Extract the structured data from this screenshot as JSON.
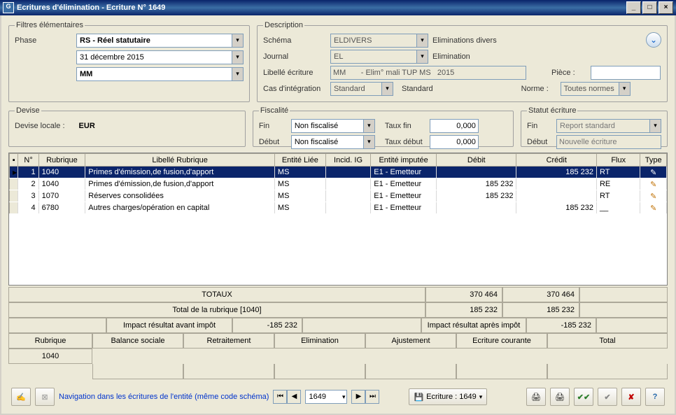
{
  "window": {
    "title": "Ecritures d'élimination - Ecriture N° 1649"
  },
  "filters": {
    "legend": "Filtres élémentaires",
    "phase_label": "Phase",
    "phase_value": "RS - Réel statutaire",
    "date_value": "31 décembre 2015",
    "code_value": "MM"
  },
  "description": {
    "legend": "Description",
    "schema_label": "Schéma",
    "schema_value": "ELDIVERS",
    "schema_desc": "Eliminations divers",
    "journal_label": "Journal",
    "journal_value": "EL",
    "journal_desc": "Elimination",
    "libelle_label": "Libellé écriture",
    "libelle_value": "MM       - Elim° mali TUP MS   2015",
    "cas_label": "Cas d'intégration",
    "cas_value": "Standard",
    "cas_desc": "Standard",
    "piece_label": "Pièce :",
    "piece_value": "",
    "norme_label": "Norme :",
    "norme_value": "Toutes normes"
  },
  "devise": {
    "legend": "Devise",
    "local_label": "Devise locale :",
    "local_value": "EUR"
  },
  "fiscalite": {
    "legend": "Fiscalité",
    "fin_label": "Fin",
    "fin_value": "Non fiscalisé",
    "debut_label": "Début",
    "debut_value": "Non fiscalisé",
    "tauxfin_label": "Taux fin",
    "tauxfin_value": "0,000",
    "tauxdebut_label": "Taux début",
    "tauxdebut_value": "0,000"
  },
  "statut": {
    "legend": "Statut écriture",
    "fin_label": "Fin",
    "fin_value": "Report standard",
    "debut_label": "Début",
    "debut_value": "Nouvelle écriture"
  },
  "grid": {
    "cols": [
      "N°",
      "Rubrique",
      "Libellé Rubrique",
      "Entité Liée",
      "Incid. IG",
      "Entité imputée",
      "Débit",
      "Crédit",
      "Flux",
      "Type"
    ],
    "rows": [
      {
        "n": "1",
        "rub": "1040",
        "lib": "Primes d'émission,de fusion,d'apport",
        "ent": "MS",
        "ig": "",
        "imp": "E1 - Emetteur",
        "debit": "",
        "credit": "185 232",
        "flux": "RT",
        "selected": true
      },
      {
        "n": "2",
        "rub": "1040",
        "lib": "Primes d'émission,de fusion,d'apport",
        "ent": "MS",
        "ig": "",
        "imp": "E1 - Emetteur",
        "debit": "185 232",
        "credit": "",
        "flux": "RE"
      },
      {
        "n": "3",
        "rub": "1070",
        "lib": "Réserves consolidées",
        "ent": "MS",
        "ig": "",
        "imp": "E1 - Emetteur",
        "debit": "185 232",
        "credit": "",
        "flux": "RT"
      },
      {
        "n": "4",
        "rub": "6780",
        "lib": "Autres charges/opération en capital",
        "ent": "MS",
        "ig": "",
        "imp": "E1 - Emetteur",
        "debit": "",
        "credit": "185 232",
        "flux": "__"
      }
    ]
  },
  "totals": {
    "totaux_label": "TOTAUX",
    "totaux_debit": "370 464",
    "totaux_credit": "370 464",
    "rubrique_total_label": "Total de la rubrique [1040]",
    "rubrique_debit": "185 232",
    "rubrique_credit": "185 232",
    "impact_avant_label": "Impact résultat avant impôt",
    "impact_avant_value": "-185 232",
    "impact_apres_label": "Impact résultat après impôt",
    "impact_apres_value": "-185 232"
  },
  "tabs": {
    "rubrique_label": "Rubrique",
    "rubrique_value": "1040",
    "balance": "Balance sociale",
    "retraitement": "Retraitement",
    "elimination": "Elimination",
    "ajustement": "Ajustement",
    "courante": "Ecriture courante",
    "total": "Total"
  },
  "footer": {
    "nav_text": "Navigation dans les écritures de l'entité (même code schéma)",
    "nav_value": "1649",
    "ecr_btn": "Ecriture : 1649"
  }
}
